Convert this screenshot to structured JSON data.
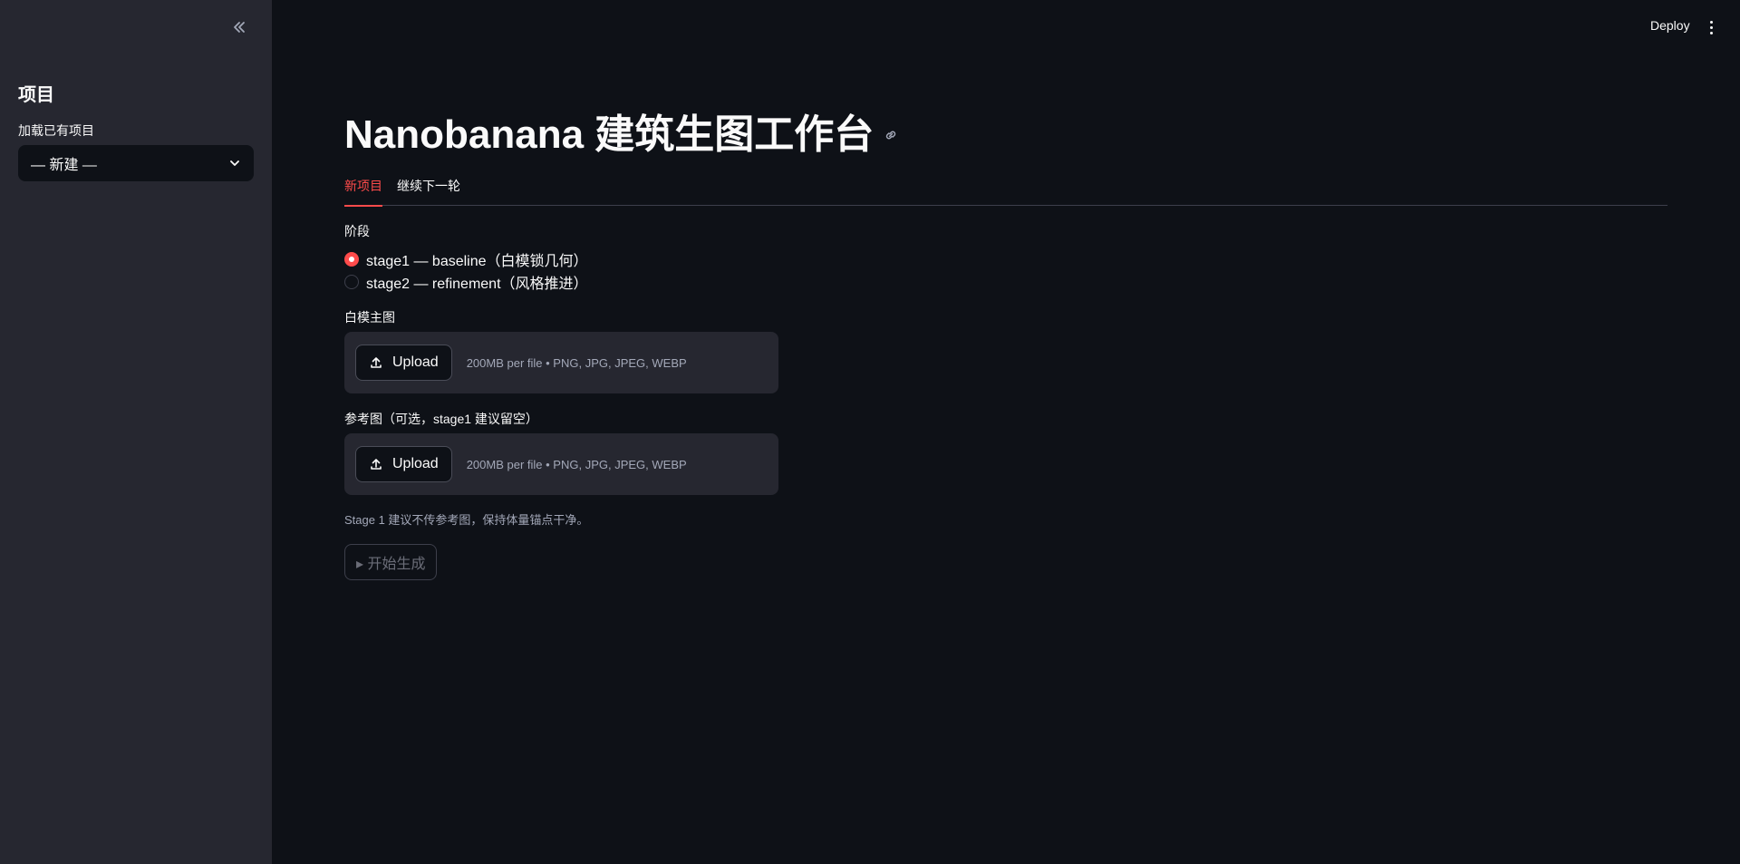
{
  "sidebar": {
    "title": "项目",
    "load_label": "加载已有项目",
    "select_value": "— 新建 —"
  },
  "header": {
    "deploy_label": "Deploy"
  },
  "main": {
    "title": "Nanobanana 建筑生图工作台",
    "tabs": [
      {
        "label": "新项目",
        "active": true
      },
      {
        "label": "继续下一轮",
        "active": false
      }
    ],
    "stage_label": "阶段",
    "stage_options": [
      {
        "label": "stage1 — baseline（白模锁几何）",
        "checked": true
      },
      {
        "label": "stage2 — refinement（风格推进）",
        "checked": false
      }
    ],
    "uploaders": [
      {
        "label": "白模主图",
        "button": "Upload",
        "hint": "200MB per file • PNG, JPG, JPEG, WEBP"
      },
      {
        "label": "参考图（可选，stage1 建议留空）",
        "button": "Upload",
        "hint": "200MB per file • PNG, JPG, JPEG, WEBP"
      }
    ],
    "caption": "Stage 1 建议不传参考图，保持体量锚点干净。",
    "start_button": "▸ 开始生成"
  },
  "colors": {
    "background": "#0e1117",
    "sidebar": "#262730",
    "accent": "#ff4b4b",
    "text": "#fafafa",
    "muted": "#a3a8b8"
  }
}
